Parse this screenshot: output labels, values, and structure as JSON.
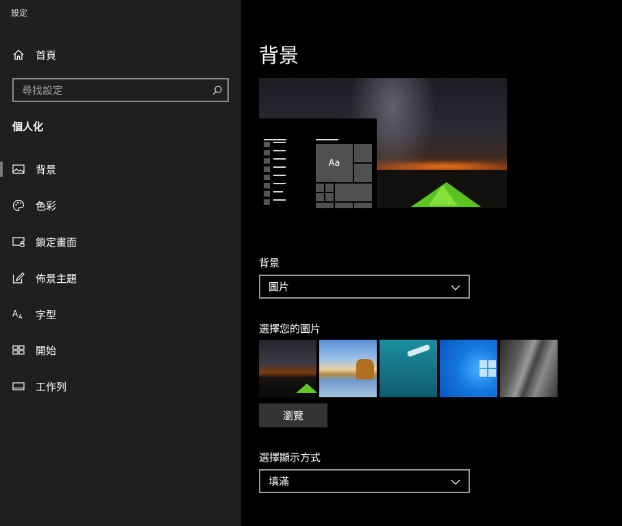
{
  "app": {
    "title": "設定"
  },
  "sidebar": {
    "home_label": "首頁",
    "search": {
      "placeholder": "尋找設定",
      "value": ""
    },
    "section_title": "個人化",
    "items": [
      {
        "label": "背景",
        "icon": "picture-icon",
        "selected": true
      },
      {
        "label": "色彩",
        "icon": "palette-icon",
        "selected": false
      },
      {
        "label": "鎖定畫面",
        "icon": "lock-screen-icon",
        "selected": false
      },
      {
        "label": "佈景主題",
        "icon": "theme-icon",
        "selected": false
      },
      {
        "label": "字型",
        "icon": "font-icon",
        "selected": false
      },
      {
        "label": "開始",
        "icon": "start-icon",
        "selected": false
      },
      {
        "label": "工作列",
        "icon": "taskbar-icon",
        "selected": false
      }
    ]
  },
  "main": {
    "page_title": "背景",
    "preview_sample_text": "Aa",
    "background_label": "背景",
    "background_value": "圖片",
    "choose_picture_label": "選擇您的圖片",
    "browse_label": "瀏覽",
    "fit_label": "選擇顯示方式",
    "fit_value": "填滿"
  },
  "colors": {
    "sidebar_bg": "#1f1f1f",
    "main_bg": "#000000",
    "selection_indicator": "#7a7a7a",
    "button_bg": "#333333"
  }
}
